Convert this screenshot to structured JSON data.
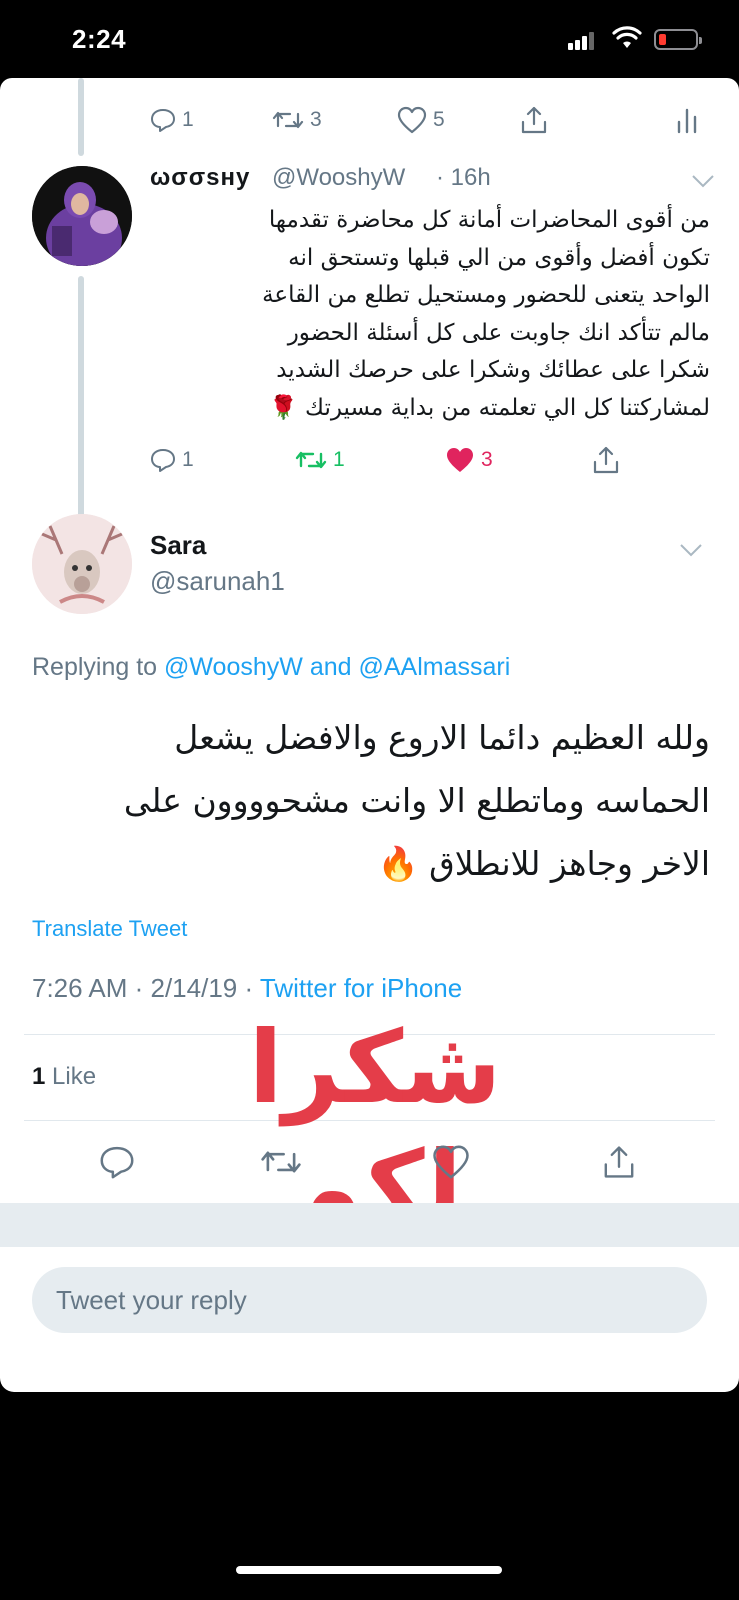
{
  "status_bar": {
    "time": "2:24"
  },
  "tweet_top_actions": {
    "reply_count": "1",
    "retweet_count": "3",
    "like_count": "5"
  },
  "tweet1": {
    "display_name": "ωσσsнy",
    "handle": "@WooshyW",
    "age": "· 16h",
    "text_lines": [
      "من أقوى المحاضرات أمانة كل محاضرة تقدمها",
      "تكون أفضل وأقوى من الي قبلها وتستحق انه",
      "الواحد يتعنى للحضور ومستحيل تطلع من القاعة",
      "مالم تتأكد انك جاوبت على كل أسئلة الحضور",
      "شكرا على عطائك وشكرا على حرصك الشديد",
      "لمشاركتنا كل الي تعلمته من بداية مسيرتك 🌹"
    ],
    "reply_count": "1",
    "retweet_count": "1",
    "like_count": "3",
    "retweet_color": "#17bf63",
    "like_color": "#e0245e"
  },
  "tweet2": {
    "display_name": "Sara",
    "handle": "@sarunah1",
    "replying_prefix": "Replying to",
    "replying_user1": "@WooshyW",
    "replying_and": "and",
    "replying_user2": "@AAlmassari",
    "text_lines": [
      "ولله العظيم دائما الاروع والافضل يشعل",
      "الحماسه وماتطلع الا وانت مشحوووون على",
      "الاخر وجاهز للانطلاق 🔥"
    ],
    "translate_label": "Translate Tweet",
    "timestamp": "7:26 AM · 2/14/19 ·",
    "source": "Twitter for iPhone",
    "likes_count": "1",
    "likes_label": "Like"
  },
  "overlay_text": "شكرا لكم",
  "reply_box": {
    "placeholder": "Tweet your reply"
  },
  "colors": {
    "link": "#1da1f2",
    "secondary": "#657786",
    "overlay": "#e43d49"
  }
}
